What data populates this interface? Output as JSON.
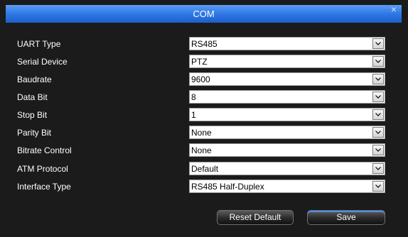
{
  "dialog": {
    "title": "COM",
    "close_glyph": "×"
  },
  "rows": [
    {
      "label": "UART Type",
      "value": "RS485"
    },
    {
      "label": "Serial Device",
      "value": "PTZ"
    },
    {
      "label": "Baudrate",
      "value": "9600"
    },
    {
      "label": "Data Bit",
      "value": "8"
    },
    {
      "label": "Stop Bit",
      "value": "1"
    },
    {
      "label": "Parity Bit",
      "value": "None"
    },
    {
      "label": "Bitrate Control",
      "value": "None"
    },
    {
      "label": "ATM Protocol",
      "value": "Default"
    },
    {
      "label": "Interface Type",
      "value": "RS485 Half-Duplex"
    }
  ],
  "buttons": {
    "reset_label": "Reset Default",
    "save_label": "Save"
  },
  "colors": {
    "titlebar_accent": "#2f78e6",
    "background": "#1b1b1b",
    "field_background": "#ffffff"
  },
  "icons": {
    "close": "close-icon",
    "dropdown": "chevron-down-icon"
  }
}
